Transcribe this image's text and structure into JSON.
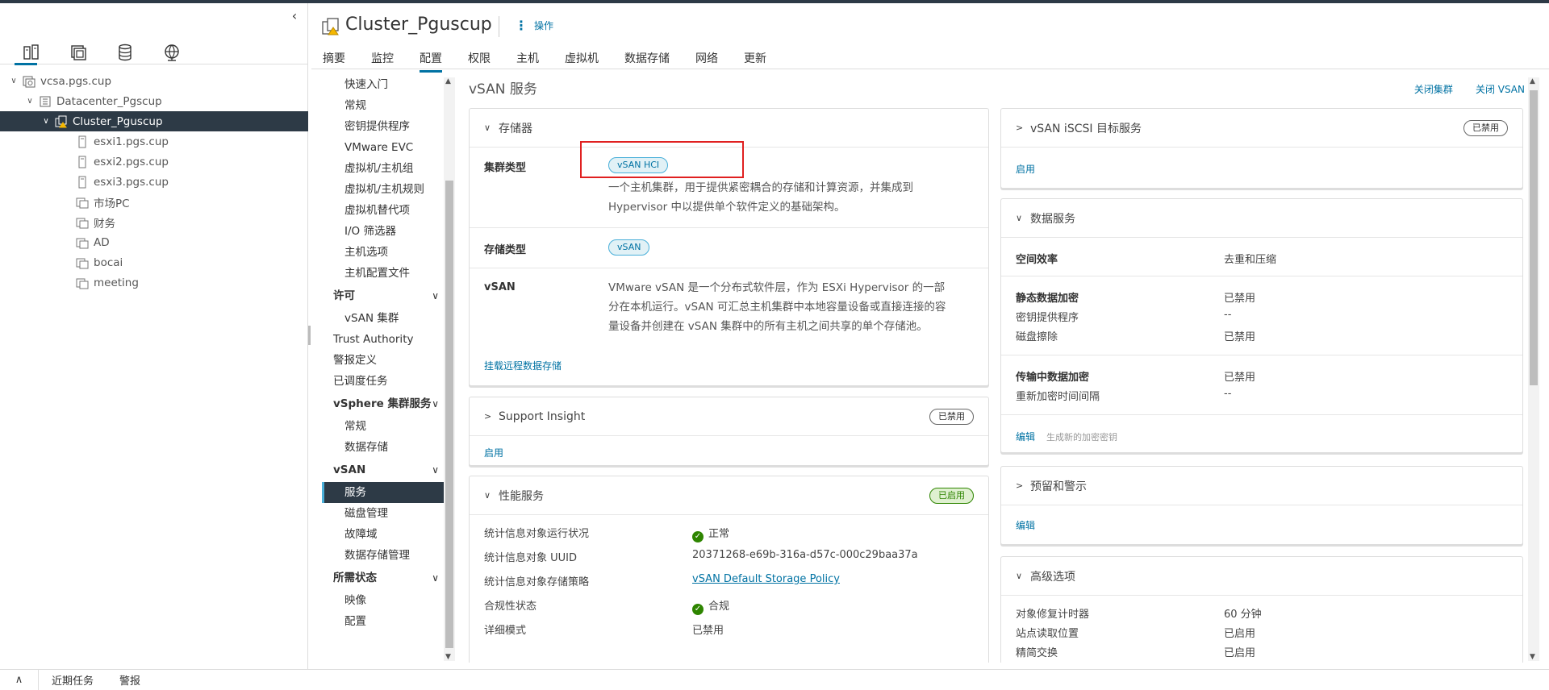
{
  "navigator": {
    "tabs": [
      "hosts-clusters",
      "vms-templates",
      "storage",
      "networking"
    ],
    "tree": [
      {
        "label": "vcsa.pgs.cup",
        "level": 0,
        "toggle": "∨",
        "icon": "vcenter-icon"
      },
      {
        "label": "Datacenter_Pgscup",
        "level": 1,
        "toggle": "∨",
        "icon": "datacenter-icon"
      },
      {
        "label": "Cluster_Pguscup",
        "level": 2,
        "toggle": "∨",
        "icon": "cluster-icon",
        "selected": true
      },
      {
        "label": "esxi1.pgs.cup",
        "level": 3,
        "toggle": "",
        "icon": "host-icon"
      },
      {
        "label": "esxi2.pgs.cup",
        "level": 3,
        "toggle": "",
        "icon": "host-icon"
      },
      {
        "label": "esxi3.pgs.cup",
        "level": 3,
        "toggle": "",
        "icon": "host-icon"
      },
      {
        "label": "市场PC",
        "level": 3,
        "toggle": "",
        "icon": "vm-icon"
      },
      {
        "label": "财务",
        "level": 3,
        "toggle": "",
        "icon": "vm-icon"
      },
      {
        "label": "AD",
        "level": 3,
        "toggle": "",
        "icon": "vm-icon"
      },
      {
        "label": "bocai",
        "level": 3,
        "toggle": "",
        "icon": "vm-icon"
      },
      {
        "label": "meeting",
        "level": 3,
        "toggle": "",
        "icon": "vm-icon"
      }
    ]
  },
  "header": {
    "title": "Cluster_Pguscup",
    "actions_label": "操作",
    "tabs": [
      "摘要",
      "监控",
      "配置",
      "权限",
      "主机",
      "虚拟机",
      "数据存储",
      "网络",
      "更新"
    ],
    "active_tab": "配置"
  },
  "config_nav": [
    {
      "type": "item",
      "label": "快速入门"
    },
    {
      "type": "item",
      "label": "常规"
    },
    {
      "type": "item",
      "label": "密钥提供程序"
    },
    {
      "type": "item",
      "label": "VMware EVC"
    },
    {
      "type": "item",
      "label": "虚拟机/主机组"
    },
    {
      "type": "item",
      "label": "虚拟机/主机规则"
    },
    {
      "type": "item",
      "label": "虚拟机替代项"
    },
    {
      "type": "item",
      "label": "I/O 筛选器"
    },
    {
      "type": "item",
      "label": "主机选项"
    },
    {
      "type": "item",
      "label": "主机配置文件"
    },
    {
      "type": "group",
      "label": "许可"
    },
    {
      "type": "item",
      "label": "vSAN 集群"
    },
    {
      "type": "top",
      "label": "Trust Authority"
    },
    {
      "type": "top",
      "label": "警报定义"
    },
    {
      "type": "top",
      "label": "已调度任务"
    },
    {
      "type": "group",
      "label": "vSphere 集群服务"
    },
    {
      "type": "item",
      "label": "常规"
    },
    {
      "type": "item",
      "label": "数据存储"
    },
    {
      "type": "group",
      "label": "vSAN"
    },
    {
      "type": "item",
      "label": "服务",
      "selected": true
    },
    {
      "type": "item",
      "label": "磁盘管理"
    },
    {
      "type": "item",
      "label": "故障域"
    },
    {
      "type": "item",
      "label": "数据存储管理"
    },
    {
      "type": "group",
      "label": "所需状态"
    },
    {
      "type": "item",
      "label": "映像"
    },
    {
      "type": "item",
      "label": "配置"
    }
  ],
  "page": {
    "title": "vSAN 服务",
    "action_shutdown_cluster": "关闭集群",
    "action_disable_vsan": "关闭 VSAN"
  },
  "storage_card": {
    "title": "存储器",
    "cluster_type_label": "集群类型",
    "cluster_type_value": "vSAN HCI",
    "cluster_type_desc_1": "一个主机集群，用于提供紧密耦合的存储和计算资源，并集成到",
    "cluster_type_desc_2": "Hypervisor 中以提供单个软件定义的基础架构。",
    "storage_type_label": "存储类型",
    "storage_type_value": "vSAN",
    "vsan_label": "vSAN",
    "vsan_desc_1": "VMware vSAN 是一个分布式软件层，作为 ESXi Hypervisor 的一部",
    "vsan_desc_2": "分在本机运行。vSAN 可汇总主机集群中本地容量设备或直接连接的容",
    "vsan_desc_3": "量设备并创建在 vSAN 集群中的所有主机之间共享的单个存储池。",
    "mount_link": "挂载远程数据存储"
  },
  "support_card": {
    "title": "Support Insight",
    "badge": "已禁用",
    "link": "启用"
  },
  "perf_card": {
    "title": "性能服务",
    "badge": "已启用",
    "rows": [
      {
        "label": "统计信息对象运行状况",
        "value": "正常",
        "icon": "ok-icon"
      },
      {
        "label": "统计信息对象 UUID",
        "value": "20371268-e69b-316a-d57c-000c29baa37a"
      },
      {
        "label": "统计信息对象存储策略",
        "value": "vSAN Default Storage Policy",
        "link": true
      },
      {
        "label": "合规性状态",
        "value": "合规",
        "icon": "ok-icon"
      },
      {
        "label": "详细模式",
        "value": "已禁用"
      }
    ]
  },
  "iscsi_card": {
    "title": "vSAN iSCSI 目标服务",
    "badge": "已禁用",
    "link": "启用"
  },
  "data_card": {
    "title": "数据服务",
    "space_eff_label": "空间效率",
    "space_eff_value": "去重和压缩",
    "encrypt_label": "静态数据加密",
    "encrypt_value": "已禁用",
    "kms_label": "密钥提供程序",
    "kms_value": "--",
    "wipe_label": "磁盘擦除",
    "wipe_value": "已禁用",
    "transit_label": "传输中数据加密",
    "transit_value": "已禁用",
    "rekey_label": "重新加密时间间隔",
    "rekey_value": "--",
    "edit_link": "编辑",
    "gen_key_link": "生成新的加密密钥"
  },
  "alert_card": {
    "title": "预留和警示",
    "link": "编辑"
  },
  "adv_card": {
    "title": "高级选项",
    "rows": [
      {
        "label": "对象修复计时器",
        "value": "60 分钟"
      },
      {
        "label": "站点读取位置",
        "value": "已启用"
      },
      {
        "label": "精简交换",
        "value": "已启用"
      }
    ]
  },
  "bottom": {
    "recent_tasks": "近期任务",
    "alarms": "警报"
  }
}
